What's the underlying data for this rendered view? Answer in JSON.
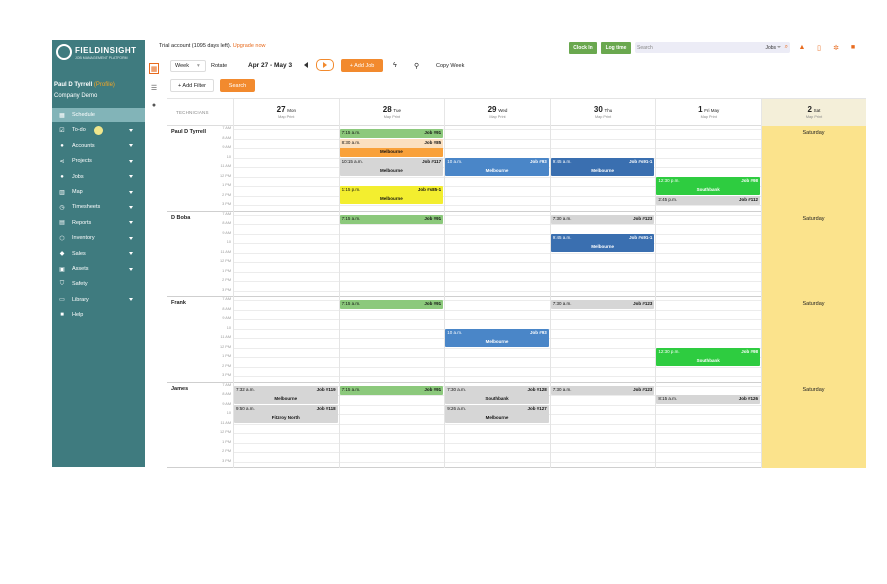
{
  "app": {
    "logo_text": "FIELDINSIGHT",
    "logo_sub": "JOB MANAGEMENT PLATFORM",
    "user_name": "Paul D Tyrrell",
    "profile_link": "(Profile)",
    "company": "Company Demo"
  },
  "sidebar": {
    "items": [
      {
        "label": "Schedule",
        "icon": "calendar-icon",
        "active": true,
        "caret": false
      },
      {
        "label": "To-do",
        "icon": "checklist-icon",
        "active": false,
        "caret": true
      },
      {
        "label": "Accounts",
        "icon": "people-icon",
        "active": false,
        "caret": true
      },
      {
        "label": "Projects",
        "icon": "share-icon",
        "active": false,
        "caret": true
      },
      {
        "label": "Jobs",
        "icon": "pin-icon",
        "active": false,
        "caret": true
      },
      {
        "label": "Map",
        "icon": "map-icon",
        "active": false,
        "caret": true
      },
      {
        "label": "Timesheets",
        "icon": "clock-icon",
        "active": false,
        "caret": true
      },
      {
        "label": "Reports",
        "icon": "report-icon",
        "active": false,
        "caret": true
      },
      {
        "label": "Inventory",
        "icon": "box-icon",
        "active": false,
        "caret": true
      },
      {
        "label": "Sales",
        "icon": "tag-icon",
        "active": false,
        "caret": true
      },
      {
        "label": "Assets",
        "icon": "asset-icon",
        "active": false,
        "caret": true
      },
      {
        "label": "Safety",
        "icon": "shield-icon",
        "active": false,
        "caret": false
      },
      {
        "label": "Library",
        "icon": "library-icon",
        "active": false,
        "caret": true
      },
      {
        "label": "Help",
        "icon": "help-icon",
        "active": false,
        "caret": false
      }
    ]
  },
  "topbar": {
    "trial_text": "Trial account (1095 days left).",
    "upgrade_text": "Upgrade now",
    "clock_in": "Clock In",
    "log_time": "Log time",
    "search_placeholder": "Search",
    "search_scope": "Jobs",
    "icons": [
      "bell-icon",
      "mobile-icon",
      "gear-icon",
      "book-icon"
    ]
  },
  "toolbar": {
    "view": "Week",
    "rotate": "Rotate",
    "date_range": "Apr 27 - May 3",
    "add_job": "+ Add Job",
    "copy_week": "Copy Week",
    "add_filter": "+ Add Filter",
    "search": "Search"
  },
  "calendar": {
    "technicians_header": "TECHNICIANS",
    "map_print": "Map Print",
    "days": [
      {
        "num": "27",
        "name": "Mon"
      },
      {
        "num": "28",
        "name": "Tue"
      },
      {
        "num": "29",
        "name": "Wed"
      },
      {
        "num": "30",
        "name": "Thu"
      },
      {
        "num": "1",
        "name": "Fri May"
      },
      {
        "num": "2",
        "name": "Sat"
      }
    ],
    "hours": [
      "7 AM",
      "8 AM",
      "9 AM",
      "10",
      "11 AM",
      "12 PM",
      "1 PM",
      "2 PM",
      "3 PM"
    ],
    "saturday_label": "Saturday",
    "technicians": [
      {
        "name": "Paul D Tyrrell",
        "jobs": [
          {
            "day": 1,
            "hour": 0,
            "time": "7:15 a.m.",
            "job": "Job #91",
            "location": "",
            "color": "#8cc97c",
            "tall": false
          },
          {
            "day": 1,
            "hour": 1,
            "time": "8:30 a.m.",
            "job": "Job #85",
            "location": "Melbourne",
            "color": "#f9a13a",
            "tall": true,
            "headColor": "#fbe0c0"
          },
          {
            "day": 1,
            "hour": 3,
            "time": "10:15 a.m.",
            "job": "Job #117",
            "location": "Melbourne",
            "color": "#d6d6d6",
            "tall": true
          },
          {
            "day": 2,
            "hour": 3,
            "time": "10 a.m.",
            "job": "Job #93",
            "location": "Melbourne",
            "color": "#4a86c8",
            "tall": true,
            "text": "#fff"
          },
          {
            "day": 3,
            "hour": 3,
            "time": "9:45 a.m.",
            "job": "Job #s91-1",
            "location": "Melbourne",
            "color": "#3a6fb0",
            "tall": true,
            "text": "#fff"
          },
          {
            "day": 1,
            "hour": 6,
            "time": "1:15 p.m.",
            "job": "Job #s85-1",
            "location": "Melbourne",
            "color": "#f3ee2f",
            "tall": true
          },
          {
            "day": 4,
            "hour": 5,
            "time": "12:30 p.m.",
            "job": "Job #98",
            "location": "Southbank",
            "color": "#2ecc40",
            "tall": true,
            "text": "#fff"
          },
          {
            "day": 4,
            "hour": 7,
            "time": "2:45 p.m.",
            "job": "Job #112",
            "location": "",
            "color": "#d6d6d6",
            "tall": false
          }
        ]
      },
      {
        "name": "D Boba",
        "jobs": [
          {
            "day": 1,
            "hour": 0,
            "time": "7:15 a.m.",
            "job": "Job #91",
            "location": "",
            "color": "#8cc97c",
            "tall": false
          },
          {
            "day": 3,
            "hour": 0,
            "time": "7:30 a.m.",
            "job": "Job #123",
            "location": "",
            "color": "#d6d6d6",
            "tall": false
          },
          {
            "day": 3,
            "hour": 2,
            "time": "9:45 a.m.",
            "job": "Job #s91-1",
            "location": "Melbourne",
            "color": "#3a6fb0",
            "tall": true,
            "text": "#fff"
          }
        ]
      },
      {
        "name": "Frank",
        "jobs": [
          {
            "day": 1,
            "hour": 0,
            "time": "7:15 a.m.",
            "job": "Job #91",
            "location": "",
            "color": "#8cc97c",
            "tall": false
          },
          {
            "day": 3,
            "hour": 0,
            "time": "7:30 a.m.",
            "job": "Job #123",
            "location": "",
            "color": "#d6d6d6",
            "tall": false
          },
          {
            "day": 2,
            "hour": 3,
            "time": "10 a.m.",
            "job": "Job #93",
            "location": "Melbourne",
            "color": "#4a86c8",
            "tall": true,
            "text": "#fff"
          },
          {
            "day": 4,
            "hour": 5,
            "time": "12:30 p.m.",
            "job": "Job #98",
            "location": "Southbank",
            "color": "#2ecc40",
            "tall": true,
            "text": "#fff"
          }
        ]
      },
      {
        "name": "James",
        "jobs": [
          {
            "day": 0,
            "hour": 0,
            "time": "7:32 a.m.",
            "job": "Job #119",
            "location": "Melbourne",
            "color": "#d6d6d6",
            "tall": true
          },
          {
            "day": 1,
            "hour": 0,
            "time": "7:15 a.m.",
            "job": "Job #91",
            "location": "",
            "color": "#8cc97c",
            "tall": false
          },
          {
            "day": 2,
            "hour": 0,
            "time": "7:30 a.m.",
            "job": "Job #128",
            "location": "Southbank",
            "color": "#d6d6d6",
            "tall": true
          },
          {
            "day": 3,
            "hour": 0,
            "time": "7:30 a.m.",
            "job": "Job #123",
            "location": "",
            "color": "#d6d6d6",
            "tall": false
          },
          {
            "day": 4,
            "hour": 1,
            "time": "8:15 a.m.",
            "job": "Job #126",
            "location": "",
            "color": "#d6d6d6",
            "tall": false
          },
          {
            "day": 0,
            "hour": 2,
            "time": "9:50 a.m.",
            "job": "Job #118",
            "location": "Fitzroy North",
            "color": "#d6d6d6",
            "tall": true
          },
          {
            "day": 2,
            "hour": 2,
            "time": "9:26 a.m.",
            "job": "Job #127",
            "location": "Melbourne",
            "color": "#d6d6d6",
            "tall": true
          }
        ]
      }
    ]
  }
}
